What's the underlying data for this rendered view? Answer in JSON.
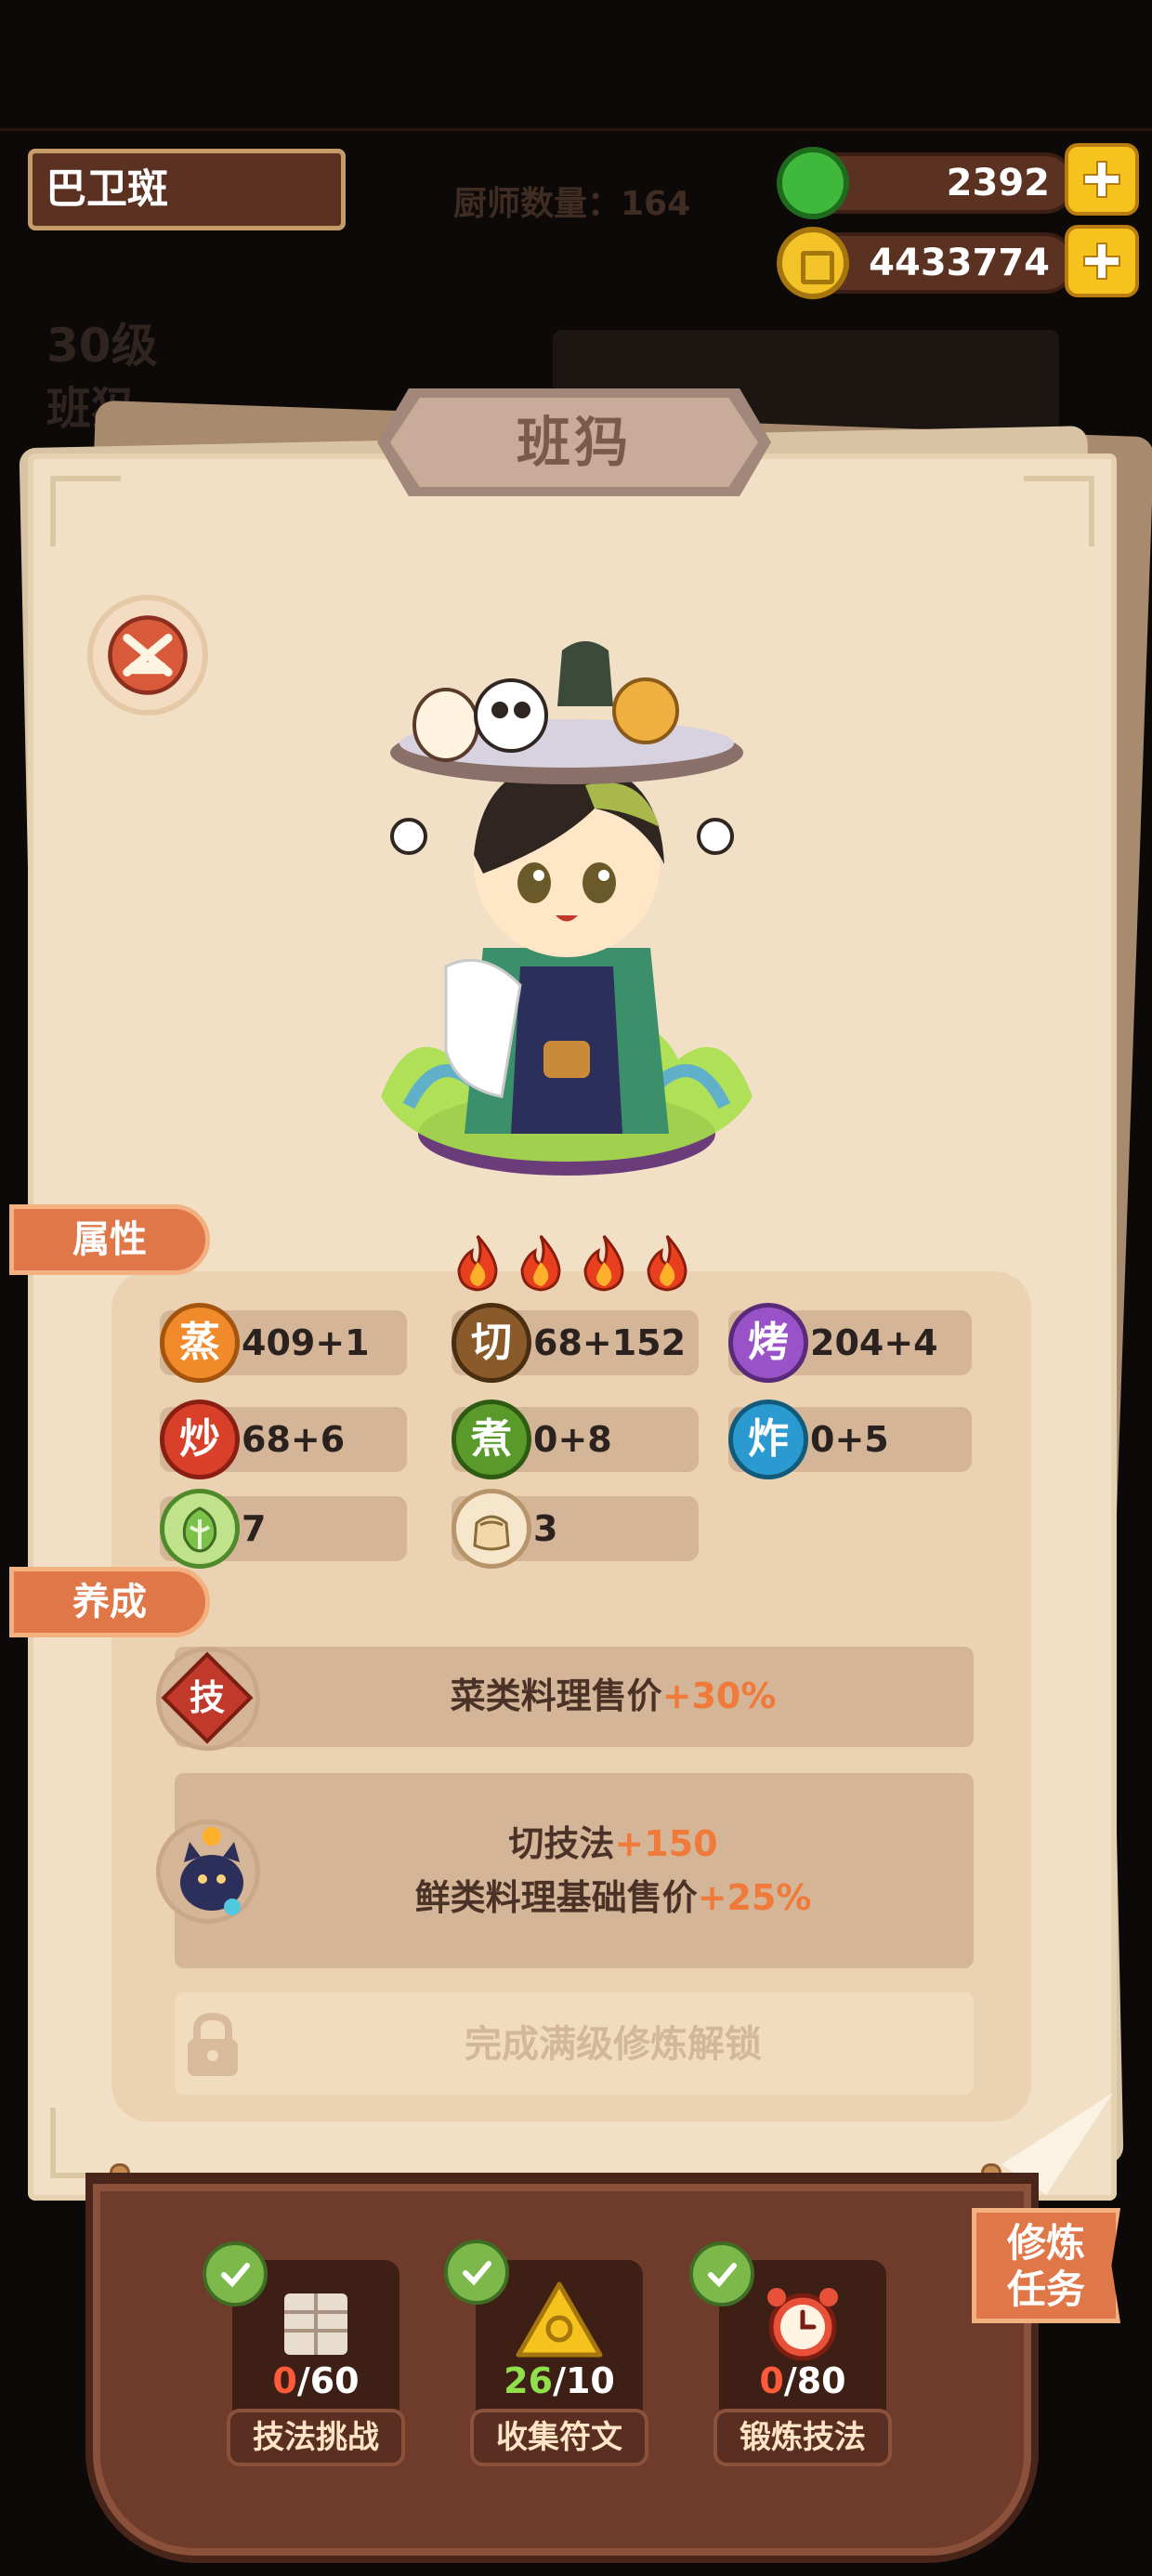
{
  "header": {
    "player_name": "巴卫斑",
    "chef_count_label": "厨师数量：164",
    "jade_amount": "2392",
    "coin_amount": "4433774"
  },
  "background": {
    "level": "30级",
    "name": "班犸"
  },
  "chef": {
    "name": "班犸",
    "stars": 4,
    "skill_icon": "crossed-knives-icon"
  },
  "tabs": {
    "attributes": "属性",
    "nurture": "养成"
  },
  "stats": [
    {
      "icon": "蒸",
      "value": "409+1",
      "color": "#f08a2a"
    },
    {
      "icon": "切",
      "value": "68+152",
      "color": "#8a5a2a"
    },
    {
      "icon": "烤",
      "value": "204+4",
      "color": "#9a52c8"
    },
    {
      "icon": "炒",
      "value": "68+6",
      "color": "#d8402a"
    },
    {
      "icon": "煮",
      "value": "0+8",
      "color": "#5a9a2a"
    },
    {
      "icon": "炸",
      "value": "0+5",
      "color": "#2a9ad0"
    }
  ],
  "materials": [
    {
      "icon": "cabbage-icon",
      "value": "7"
    },
    {
      "icon": "flour-bag-icon",
      "value": "3"
    }
  ],
  "nurture": {
    "skill_badge": "技",
    "skill_text_prefix": "菜类料理售价",
    "skill_text_bonus": "+30%",
    "bonus_line1_prefix": "切技法",
    "bonus_line1_bonus": "+150",
    "bonus_line2_prefix": "鲜类料理基础售价",
    "bonus_line2_bonus": "+25%",
    "locked_text": "完成满级修炼解锁"
  },
  "tasks": [
    {
      "count": "0",
      "total": "/60",
      "label": "技法挑战",
      "count_color": "#ff5a3a",
      "icon": "scroll-icon"
    },
    {
      "count": "26",
      "total": "/10",
      "label": "收集符文",
      "count_color": "#8fe04a",
      "icon": "rune-icon"
    },
    {
      "count": "0",
      "total": "/80",
      "label": "锻炼技法",
      "count_color": "#ff5a3a",
      "icon": "alarm-clock-icon"
    }
  ],
  "cultivate_task": {
    "line1": "修炼",
    "line2": "任务"
  },
  "colors": {
    "accent": "#e07748",
    "highlight": "#f07a3a",
    "parchment": "#f1e0c5"
  }
}
